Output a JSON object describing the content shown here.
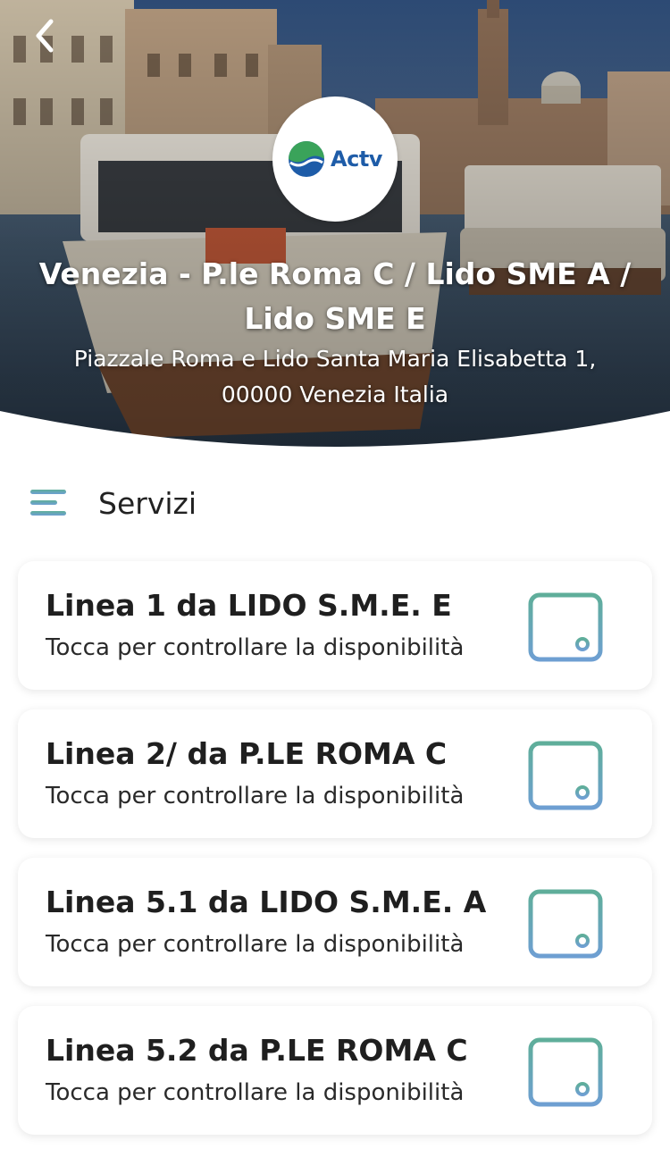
{
  "header": {
    "back_icon": "chevron-left-icon",
    "logo_text": "Actv",
    "title": "Venezia - P.le Roma C / Lido SME A / Lido SME E",
    "address": "Piazzale Roma e Lido Santa Maria Elisabetta 1, 00000 Venezia Italia"
  },
  "section": {
    "icon": "menu-lines-icon",
    "title": "Servizi"
  },
  "services": [
    {
      "title": "Linea 1 da LIDO S.M.E. E",
      "subtitle": "Tocca per controllare la disponibilità",
      "icon": "calendar-icon"
    },
    {
      "title": "Linea 2/ da P.LE ROMA C",
      "subtitle": "Tocca per controllare la disponibilità",
      "icon": "calendar-icon"
    },
    {
      "title": "Linea 5.1 da LIDO S.M.E. A",
      "subtitle": "Tocca per controllare la disponibilità",
      "icon": "calendar-icon"
    },
    {
      "title": "Linea 5.2 da P.LE ROMA C",
      "subtitle": "Tocca per controllare la disponibilità",
      "icon": "calendar-icon"
    }
  ],
  "colors": {
    "accent_teal": "#5fae9a",
    "accent_blue": "#6e9fd2",
    "logo_blue": "#1e5ca8",
    "logo_green": "#3aa35a"
  }
}
